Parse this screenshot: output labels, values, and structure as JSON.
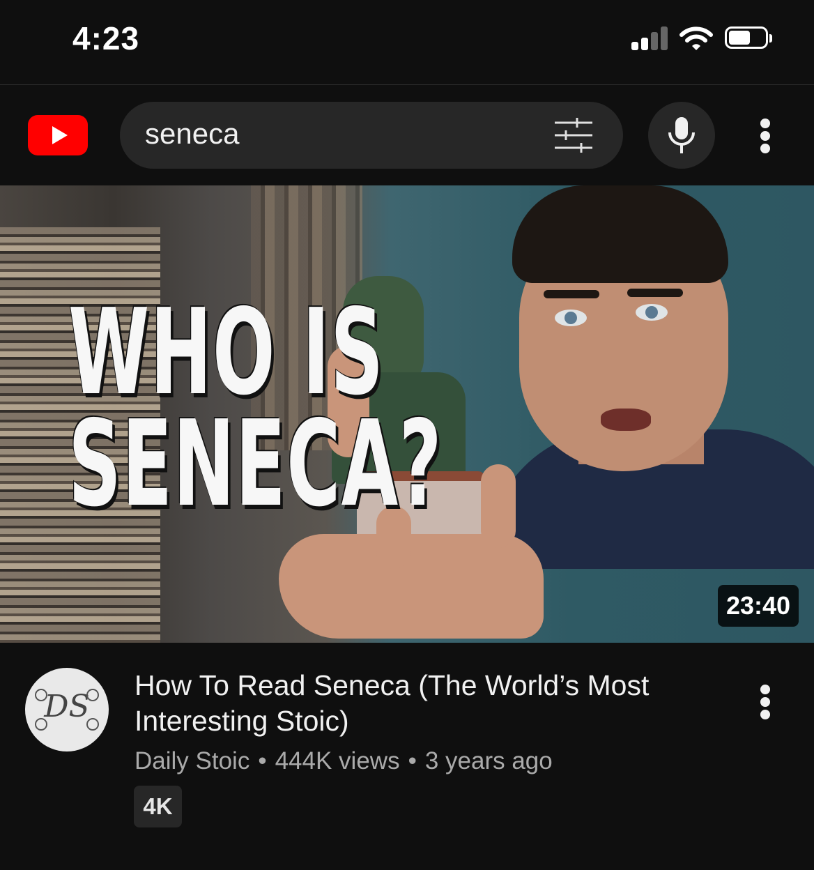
{
  "status_bar": {
    "time": "4:23",
    "icons": [
      "cellular-signal-icon",
      "wifi-icon",
      "battery-icon"
    ]
  },
  "header": {
    "logo_icon": "youtube-logo-icon",
    "search_value": "seneca",
    "filter_icon": "search-filters-icon",
    "mic_icon": "microphone-icon",
    "more_icon": "more-vertical-icon",
    "brand_color": "#ff0000"
  },
  "video": {
    "thumbnail": {
      "overlay_text_line1": "WHO IS",
      "overlay_text_line2": "SENECA?"
    },
    "duration": "23:40",
    "title": "How To Read Seneca (The World’s Most Interesting Stoic)",
    "channel": "Daily Stoic",
    "separator": "•",
    "views": "444K views",
    "age": "3 years ago",
    "badge": "4K",
    "avatar_monogram": "DS",
    "more_icon": "more-vertical-icon"
  }
}
